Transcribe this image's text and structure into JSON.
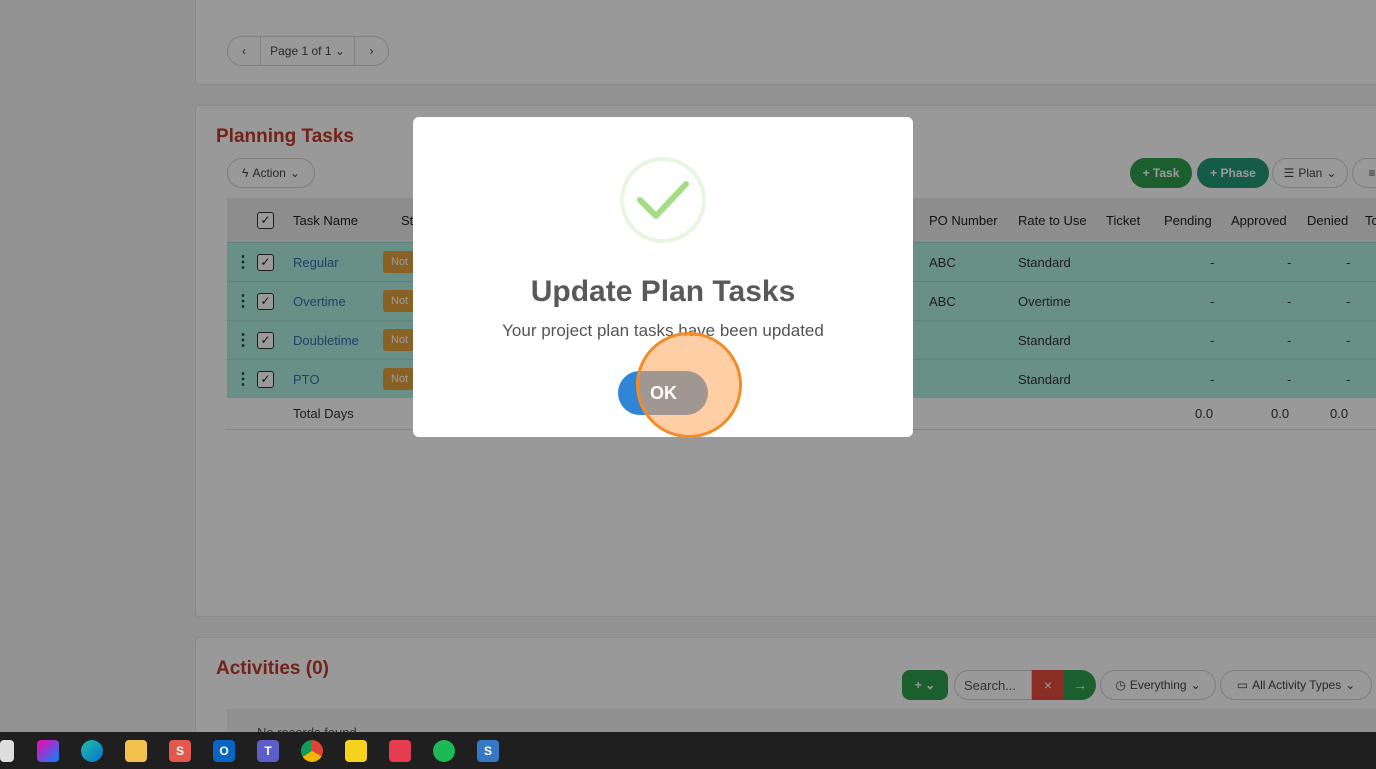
{
  "top_pager": {
    "prev": "‹",
    "page_label": "Page 1 of 1 ⌄",
    "next": "›"
  },
  "planning": {
    "title": "Planning Tasks",
    "action_label": "Action",
    "task_button": "+ Task",
    "phase_button": "+ Phase",
    "plan_button": "Plan",
    "columns": {
      "task_name": "Task Name",
      "status": "St",
      "po_number": "PO Number",
      "rate_to_use": "Rate to Use",
      "ticket": "Ticket",
      "pending": "Pending",
      "approved": "Approved",
      "denied": "Denied",
      "total": "To"
    },
    "rows": [
      {
        "name": "Regular",
        "status": "Not",
        "po": "ABC",
        "rate": "Standard",
        "pending": "-",
        "approved": "-",
        "denied": "-"
      },
      {
        "name": "Overtime",
        "status": "Not",
        "po": "ABC",
        "rate": "Overtime",
        "pending": "-",
        "approved": "-",
        "denied": "-"
      },
      {
        "name": "Doubletime",
        "status": "Not",
        "po": "",
        "rate": "Standard",
        "pending": "-",
        "approved": "-",
        "denied": "-"
      },
      {
        "name": "PTO",
        "status": "Not",
        "po": "",
        "rate": "Standard",
        "pending": "-",
        "approved": "-",
        "denied": "-"
      }
    ],
    "footer": {
      "label": "Total Days",
      "pending": "0.0",
      "approved": "0.0",
      "denied": "0.0"
    }
  },
  "activities": {
    "title": "Activities (0)",
    "add_button": "+ ⌄",
    "search_placeholder": "Search...",
    "clear": "×",
    "go": "→",
    "filter_everything": "Everything",
    "filter_types": "All Activity Types",
    "empty_text": "No records found"
  },
  "modal": {
    "title": "Update Plan Tasks",
    "message": "Your project plan tasks have been updated",
    "ok": "OK"
  },
  "colors": {
    "accent_title": "#c0392b",
    "row_highlight": "#b0f0df",
    "ok_button": "#3085d6",
    "success_check": "#a5dc86",
    "click_marker": "#f08c2a"
  },
  "taskbar": {
    "icons": [
      "start-icon",
      "copilot-icon",
      "edge-icon",
      "file-explorer-icon",
      "s-app-icon",
      "outlook-icon",
      "teams-icon",
      "chrome-icon",
      "sticky-notes-icon",
      "app-icon",
      "spotify-icon",
      "s-app-2-icon"
    ]
  }
}
